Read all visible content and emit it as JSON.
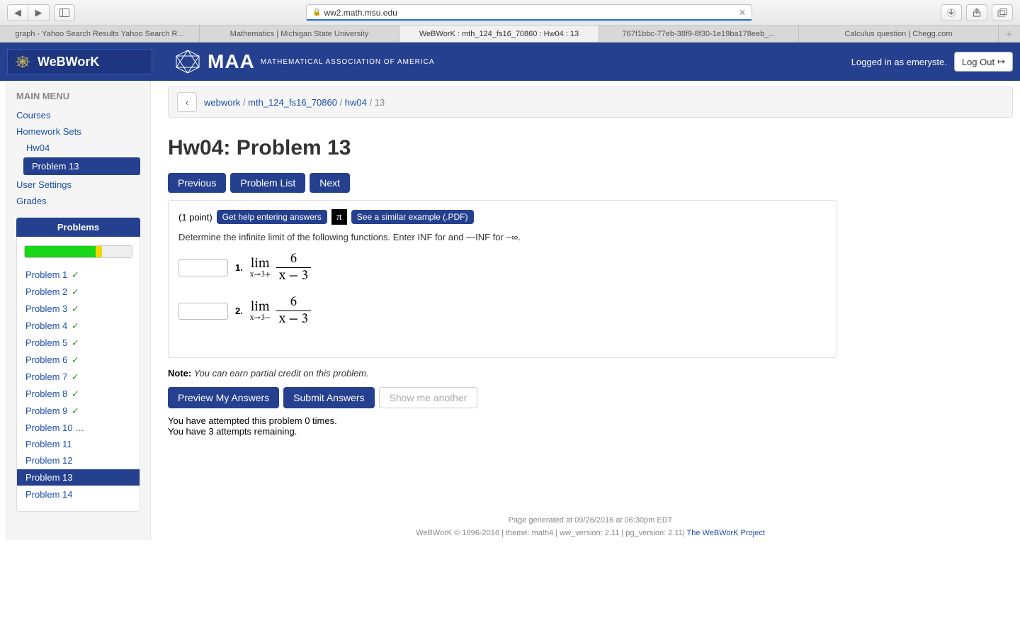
{
  "browser": {
    "url_host": "ww2.math.msu.edu",
    "tabs": [
      "graph - Yahoo Search Results Yahoo Search R...",
      "Mathematics | Michigan State University",
      "WeBWorK : mth_124_fs16_70860 : Hw04 : 13",
      "767f1bbc-77eb-38f9-8f30-1e19ba178eeb_...",
      "Calculus question | Chegg.com"
    ],
    "active_tab_index": 2
  },
  "header": {
    "brand": "WeBWorK",
    "org_abbr": "MAA",
    "org_full": "MATHEMATICAL ASSOCIATION OF AMERICA",
    "logged_in": "Logged in as emeryste.",
    "logout": "Log Out"
  },
  "breadcrumb": {
    "items": [
      "webwork",
      "mth_124_fs16_70860",
      "hw04"
    ],
    "current": "13"
  },
  "sidebar": {
    "main_title": "MAIN MENU",
    "links": {
      "courses": "Courses",
      "hwsets": "Homework Sets",
      "hw04": "Hw04",
      "problem13": "Problem 13",
      "user_settings": "User Settings",
      "grades": "Grades"
    },
    "panel_title": "Problems",
    "progress": {
      "green_pct": 66,
      "yellow_pct": 6
    },
    "problems": [
      {
        "label": "Problem 1",
        "done": true
      },
      {
        "label": "Problem 2",
        "done": true
      },
      {
        "label": "Problem 3",
        "done": true
      },
      {
        "label": "Problem 4",
        "done": true
      },
      {
        "label": "Problem 5",
        "done": true
      },
      {
        "label": "Problem 6",
        "done": true
      },
      {
        "label": "Problem 7",
        "done": true
      },
      {
        "label": "Problem 8",
        "done": true
      },
      {
        "label": "Problem 9",
        "done": true
      },
      {
        "label": "Problem 10 …",
        "done": false
      },
      {
        "label": "Problem 11",
        "done": false
      },
      {
        "label": "Problem 12",
        "done": false
      },
      {
        "label": "Problem 13",
        "done": false,
        "active": true
      },
      {
        "label": "Problem 14",
        "done": false
      }
    ]
  },
  "page": {
    "title": "Hw04: Problem 13",
    "nav": {
      "prev": "Previous",
      "list": "Problem List",
      "next": "Next"
    },
    "box": {
      "points": "(1 point)",
      "help": "Get help entering answers",
      "similar": "See a similar example (.PDF)",
      "instructions": "Determine the infinite limit of the following functions. Enter INF for  and —INF for  −∞.",
      "q1_num": "1.",
      "q2_num": "2.",
      "lim_top": "lim",
      "lim_sub_plus": "x→3+",
      "lim_sub_minus": "x→3−",
      "frac_num": "6",
      "frac_den": "x − 3"
    },
    "note_label": "Note:",
    "note_text": " You can earn partial credit on this problem.",
    "actions": {
      "preview": "Preview My Answers",
      "submit": "Submit Answers",
      "another": "Show me another"
    },
    "attempt_line1": "You have attempted this problem 0 times.",
    "attempt_line2": "You have 3 attempts remaining."
  },
  "footer": {
    "line1": "Page generated at 09/26/2016 at 06:30pm EDT",
    "line2a": "WeBWorK © 1996-2016 | theme: math4 | ww_version: 2.11 | pg_version: 2.11| ",
    "line2b": "The WeBWorK Project"
  }
}
